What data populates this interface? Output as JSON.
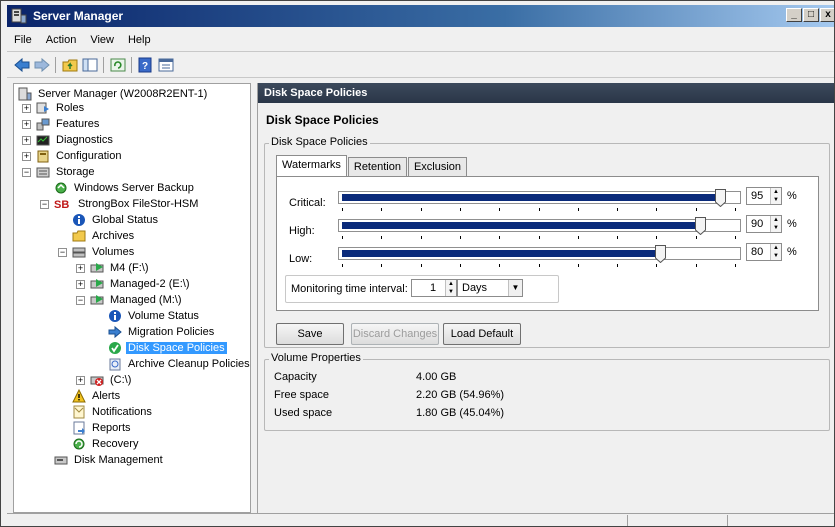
{
  "window": {
    "title": "Server Manager",
    "btn_min": "_",
    "btn_max": "□",
    "btn_close": "x"
  },
  "menu": [
    "File",
    "Action",
    "View",
    "Help"
  ],
  "tree": [
    {
      "label": "Server Manager (W2008R2ENT-1)",
      "icon": "server-icon"
    },
    {
      "label": "Roles",
      "icon": "roles-icon"
    },
    {
      "label": "Features",
      "icon": "features-icon"
    },
    {
      "label": "Diagnostics",
      "icon": "diagnostics-icon"
    },
    {
      "label": "Configuration",
      "icon": "configuration-icon"
    },
    {
      "label": "Storage",
      "icon": "storage-icon"
    },
    {
      "label": "Windows Server Backup",
      "icon": "backup-icon"
    },
    {
      "label": "StrongBox FileStor-HSM",
      "icon": "strongbox-logo-icon"
    },
    {
      "label": "Global Status",
      "icon": "info-icon"
    },
    {
      "label": "Archives",
      "icon": "folder-icon"
    },
    {
      "label": "Volumes",
      "icon": "volumes-icon"
    },
    {
      "label": "M4 (F:\\)",
      "icon": "volume-icon"
    },
    {
      "label": "Managed-2 (E:\\)",
      "icon": "volume-icon"
    },
    {
      "label": "Managed (M:\\)",
      "icon": "volume-icon"
    },
    {
      "label": "Volume Status",
      "icon": "info-icon"
    },
    {
      "label": "Migration Policies",
      "icon": "arrow-right-icon"
    },
    {
      "label": "Disk Space Policies",
      "icon": "check-circle-icon"
    },
    {
      "label": "Archive Cleanup Policies",
      "icon": "cleanup-icon"
    },
    {
      "label": "(C:\\)",
      "icon": "volume-error-icon"
    },
    {
      "label": "Alerts",
      "icon": "warning-icon"
    },
    {
      "label": "Notifications",
      "icon": "notifications-icon"
    },
    {
      "label": "Reports",
      "icon": "reports-icon"
    },
    {
      "label": "Recovery",
      "icon": "recovery-icon"
    },
    {
      "label": "Disk Management",
      "icon": "disk-management-icon"
    }
  ],
  "panel": {
    "header": "Disk Space Policies",
    "title": "Disk Space Policies",
    "group_title": "Disk Space Policies",
    "tabs": [
      "Watermarks",
      "Retention",
      "Exclusion"
    ],
    "active_tab": "Watermarks",
    "watermarks": [
      {
        "label": "Critical:",
        "value": "95",
        "level": 0.95
      },
      {
        "label": "High:",
        "value": "90",
        "level": 0.9
      },
      {
        "label": "Low:",
        "value": "80",
        "level": 0.8
      }
    ],
    "pct_symbol": "%",
    "monitoring_label": "Monitoring time interval:",
    "monitoring_value": "1",
    "monitoring_unit": "Days",
    "buttons": {
      "save": "Save",
      "discard": "Discard Changes",
      "load_default": "Load Default"
    },
    "volume_props": {
      "title": "Volume Properties",
      "rows": [
        {
          "label": "Capacity",
          "value": "4.00 GB"
        },
        {
          "label": "Free space",
          "value": "2.20 GB (54.96%)"
        },
        {
          "label": "Used space",
          "value": "1.80 GB (45.04%)"
        }
      ]
    }
  },
  "colors": {
    "fill": "#0a2a7a",
    "selection": "#3399ff",
    "header": "#2f3b4e"
  }
}
